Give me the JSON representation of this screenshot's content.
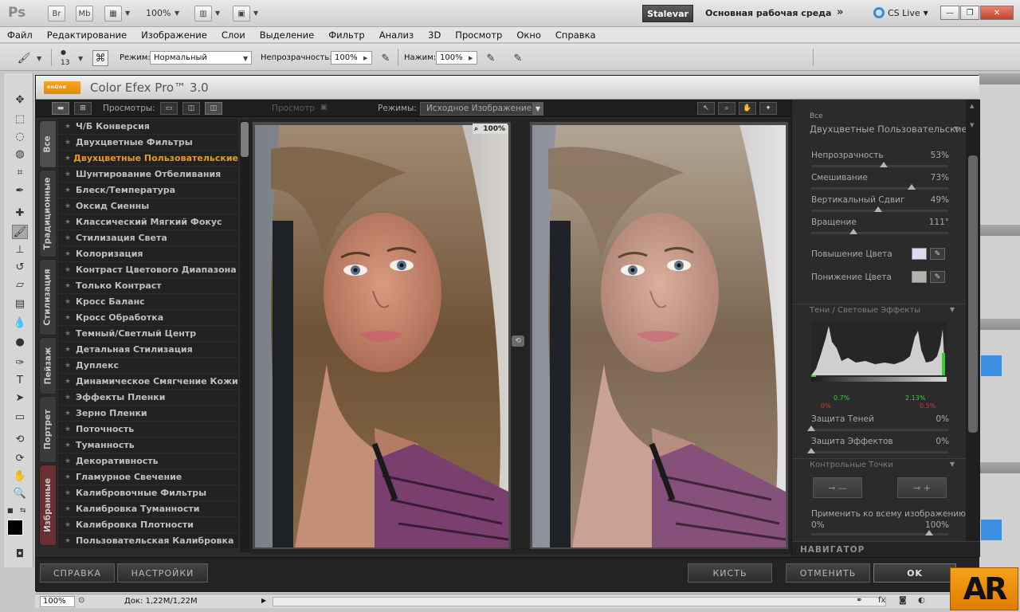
{
  "app": {
    "logo": "Ps",
    "bridge_label": "Br",
    "minibridge_label": "Mb",
    "zoom": "100%",
    "workspace_user": "Stalevar",
    "workspace_name": "Основная рабочая среда",
    "cs_live": "CS Live"
  },
  "menu": [
    "Файл",
    "Редактирование",
    "Изображение",
    "Слои",
    "Выделение",
    "Фильтр",
    "Анализ",
    "3D",
    "Просмотр",
    "Окно",
    "Справка"
  ],
  "options": {
    "brush_size": "13",
    "mode_label": "Режим:",
    "mode_value": "Нормальный",
    "opacity_label": "Непрозрачность:",
    "opacity_value": "100%",
    "pressure_label": "Нажим:",
    "pressure_value": "100%"
  },
  "plugin": {
    "logo_text": "onOne",
    "title": "Color Efex Pro™ 3.0",
    "views_label": "Просмотры:",
    "preview_label": "Просмотр",
    "modes_label": "Режимы:",
    "modes_value": "Исходное Изображение",
    "zoom_badge": "100%",
    "tabs": [
      "Все",
      "Традиционные",
      "Стилизация",
      "Пейзаж",
      "Портрет",
      "Избранные"
    ],
    "filters": [
      "Ч/Б Конверсия",
      "Двухцветные Фильтры",
      "Двухцветные Пользовательские",
      "Шунтирование Отбеливания",
      "Блеск/Температура",
      "Оксид Сиенны",
      "Классический Мягкий Фокус",
      "Стилизация Света",
      "Колоризация",
      "Контраст Цветового Диапазона",
      "Только Контраст",
      "Кросс Баланс",
      "Кросс Обработка",
      "Темный/Светлый Центр",
      "Детальная Стилизация",
      "Дуплекс",
      "Динамическое Смягчение Кожи",
      "Эффекты Пленки",
      "Зерно Пленки",
      "Поточность",
      "Туманность",
      "Декоративность",
      "Гламурное Свечение",
      "Калибровочные Фильтры",
      "Калибровка Туманности",
      "Калибровка Плотности",
      "Пользовательская Калибровка"
    ],
    "selected_filter": 2,
    "panel": {
      "category": "Все",
      "filter_name": "Двухцветные Пользовательские",
      "opacity_label": "Непрозрачность",
      "opacity_value": "53%",
      "opacity": 0.53,
      "blend_label": "Смешивание",
      "blend_value": "73%",
      "blend": 0.73,
      "vshift_label": "Вертикальный Сдвиг",
      "vshift_value": "49%",
      "vshift": 0.49,
      "rotation_label": "Вращение",
      "rotation_value": "111°",
      "rotation": 0.31,
      "upper_color_label": "Повышение Цвета",
      "upper_color": "#dcdcf0",
      "lower_color_label": "Понижение Цвета",
      "lower_color": "#b5b2ac",
      "shadows_section": "Тени / Световые Эффекты",
      "hist_l1": "0.7%",
      "hist_l2": "0%",
      "hist_r1": "2.13%",
      "hist_r2": "0.5%",
      "shadow_protect_label": "Защита Теней",
      "shadow_protect_value": "0%",
      "effect_protect_label": "Защита Эффектов",
      "effect_protect_value": "0%",
      "control_points_section": "Контрольные Точки",
      "apply_label": "Применить ко всему изображению:",
      "apply_min": "0%",
      "apply_max": "100%",
      "navigator": "НАВИГАТОР"
    },
    "buttons": {
      "help": "СПРАВКА",
      "settings": "НАСТРОЙКИ",
      "brush": "КИСТЬ",
      "cancel": "ОТМЕНИТЬ",
      "ok": "OK"
    }
  },
  "status": {
    "zoom": "100%",
    "doc": "Док: 1,22M/1,22M"
  },
  "watermark": "AR"
}
